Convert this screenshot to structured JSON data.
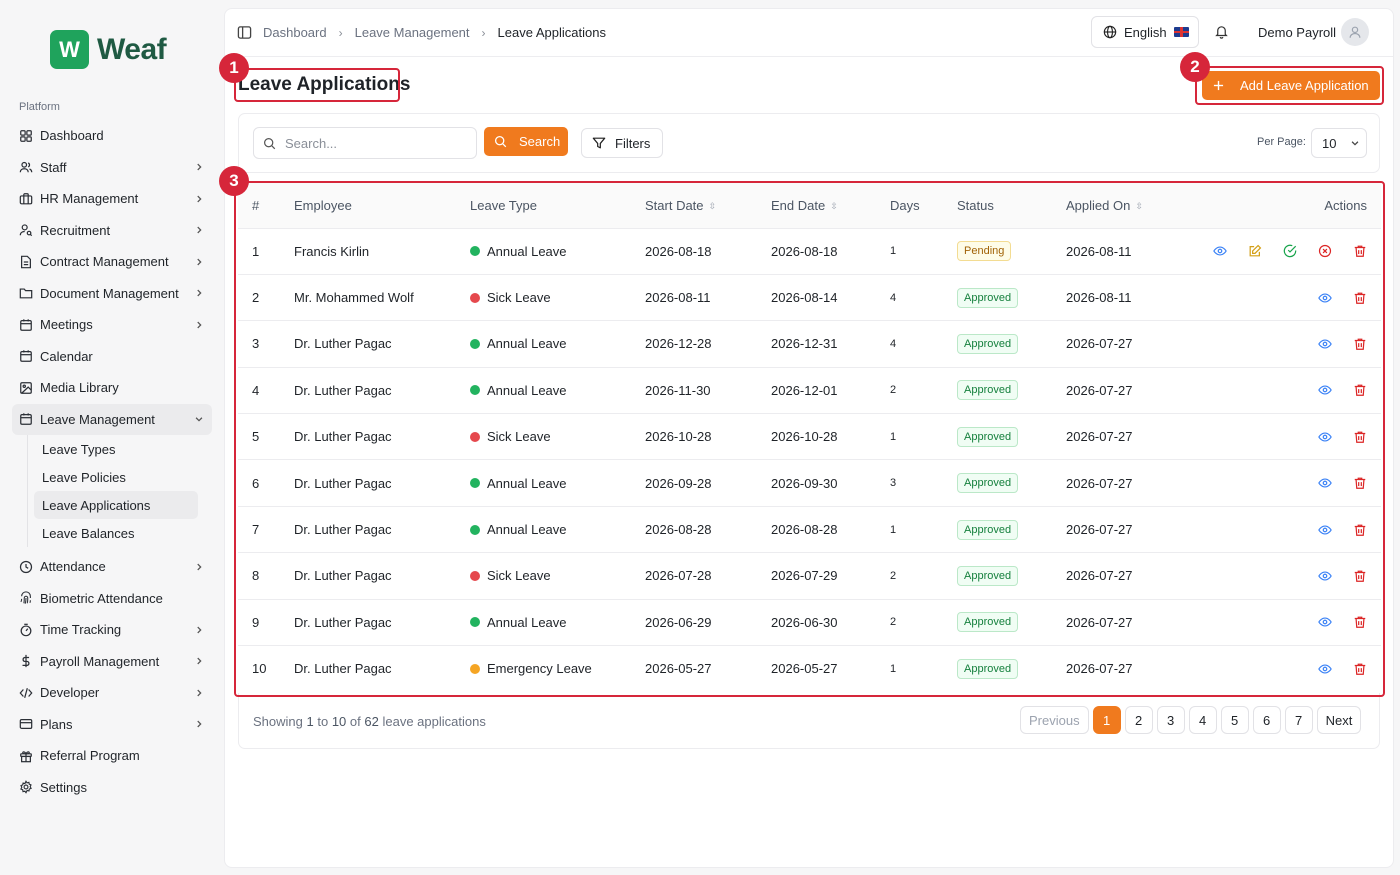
{
  "brand": {
    "logo_letter": "W",
    "name": "Weaf"
  },
  "sidebar": {
    "group_label": "Platform",
    "items": [
      {
        "label": "Dashboard",
        "icon": "grid-icon",
        "chevron": false
      },
      {
        "label": "Staff",
        "icon": "users-icon",
        "chevron": true
      },
      {
        "label": "HR Management",
        "icon": "briefcase-icon",
        "chevron": true
      },
      {
        "label": "Recruitment",
        "icon": "user-search-icon",
        "chevron": true
      },
      {
        "label": "Contract Management",
        "icon": "file-text-icon",
        "chevron": true
      },
      {
        "label": "Document Management",
        "icon": "folder-icon",
        "chevron": true
      },
      {
        "label": "Meetings",
        "icon": "calendar-icon",
        "chevron": true
      },
      {
        "label": "Calendar",
        "icon": "calendar-icon",
        "chevron": false
      },
      {
        "label": "Media Library",
        "icon": "image-icon",
        "chevron": false
      },
      {
        "label": "Leave Management",
        "icon": "calendar-icon",
        "chevron": true,
        "expanded": true
      },
      {
        "label": "Attendance",
        "icon": "clock-icon",
        "chevron": true
      },
      {
        "label": "Biometric Attendance",
        "icon": "fingerprint-icon",
        "chevron": false
      },
      {
        "label": "Time Tracking",
        "icon": "timer-icon",
        "chevron": true
      },
      {
        "label": "Payroll Management",
        "icon": "dollar-icon",
        "chevron": true
      },
      {
        "label": "Developer",
        "icon": "code-icon",
        "chevron": true
      },
      {
        "label": "Plans",
        "icon": "card-icon",
        "chevron": true
      },
      {
        "label": "Referral Program",
        "icon": "gift-icon",
        "chevron": false
      },
      {
        "label": "Settings",
        "icon": "gear-icon",
        "chevron": false
      }
    ],
    "leave_sub_items": [
      {
        "label": "Leave Types"
      },
      {
        "label": "Leave Policies"
      },
      {
        "label": "Leave Applications",
        "active": true
      },
      {
        "label": "Leave Balances"
      }
    ]
  },
  "topbar": {
    "breadcrumb": [
      "Dashboard",
      "Leave Management",
      "Leave Applications"
    ],
    "language": "English",
    "user_name": "Demo Payroll"
  },
  "page": {
    "title": "Leave Applications",
    "add_button": "Add Leave Application"
  },
  "filters": {
    "search_placeholder": "Search...",
    "search_button": "Search",
    "filters_button": "Filters",
    "per_page_label": "Per Page:",
    "per_page_value": "10"
  },
  "annotations": [
    "1",
    "2",
    "3"
  ],
  "table": {
    "columns": [
      "#",
      "Employee",
      "Leave Type",
      "Start Date",
      "End Date",
      "Days",
      "Status",
      "Applied On",
      "Actions"
    ],
    "rows": [
      {
        "num": "1",
        "employee": "Francis Kirlin",
        "type": "Annual Leave",
        "type_color": "#22b35f",
        "start": "2026-08-18",
        "end": "2026-08-18",
        "days": "1",
        "status": "Pending",
        "applied": "2026-08-11"
      },
      {
        "num": "2",
        "employee": "Mr. Mohammed Wolf",
        "type": "Sick Leave",
        "type_color": "#e5484d",
        "start": "2026-08-11",
        "end": "2026-08-14",
        "days": "4",
        "status": "Approved",
        "applied": "2026-08-11"
      },
      {
        "num": "3",
        "employee": "Dr. Luther Pagac",
        "type": "Annual Leave",
        "type_color": "#22b35f",
        "start": "2026-12-28",
        "end": "2026-12-31",
        "days": "4",
        "status": "Approved",
        "applied": "2026-07-27"
      },
      {
        "num": "4",
        "employee": "Dr. Luther Pagac",
        "type": "Annual Leave",
        "type_color": "#22b35f",
        "start": "2026-11-30",
        "end": "2026-12-01",
        "days": "2",
        "status": "Approved",
        "applied": "2026-07-27"
      },
      {
        "num": "5",
        "employee": "Dr. Luther Pagac",
        "type": "Sick Leave",
        "type_color": "#e5484d",
        "start": "2026-10-28",
        "end": "2026-10-28",
        "days": "1",
        "status": "Approved",
        "applied": "2026-07-27"
      },
      {
        "num": "6",
        "employee": "Dr. Luther Pagac",
        "type": "Annual Leave",
        "type_color": "#22b35f",
        "start": "2026-09-28",
        "end": "2026-09-30",
        "days": "3",
        "status": "Approved",
        "applied": "2026-07-27"
      },
      {
        "num": "7",
        "employee": "Dr. Luther Pagac",
        "type": "Annual Leave",
        "type_color": "#22b35f",
        "start": "2026-08-28",
        "end": "2026-08-28",
        "days": "1",
        "status": "Approved",
        "applied": "2026-07-27"
      },
      {
        "num": "8",
        "employee": "Dr. Luther Pagac",
        "type": "Sick Leave",
        "type_color": "#e5484d",
        "start": "2026-07-28",
        "end": "2026-07-29",
        "days": "2",
        "status": "Approved",
        "applied": "2026-07-27"
      },
      {
        "num": "9",
        "employee": "Dr. Luther Pagac",
        "type": "Annual Leave",
        "type_color": "#22b35f",
        "start": "2026-06-29",
        "end": "2026-06-30",
        "days": "2",
        "status": "Approved",
        "applied": "2026-07-27"
      },
      {
        "num": "10",
        "employee": "Dr. Luther Pagac",
        "type": "Emergency Leave",
        "type_color": "#f5a524",
        "start": "2026-05-27",
        "end": "2026-05-27",
        "days": "1",
        "status": "Approved",
        "applied": "2026-07-27"
      }
    ]
  },
  "footer": {
    "showing_prefix": "Showing",
    "showing_from": "1",
    "showing_to_word": "to",
    "showing_to": "10",
    "showing_of_word": "of",
    "showing_total": "62",
    "showing_suffix": "leave applications",
    "previous": "Previous",
    "pages": [
      "1",
      "2",
      "3",
      "4",
      "5",
      "6",
      "7"
    ],
    "current_page": "1",
    "next": "Next"
  },
  "colors": {
    "accent": "#f07a1e",
    "annotation": "#d6263a",
    "brand_green": "#1fa35c",
    "brand_text": "#1f5a43"
  }
}
